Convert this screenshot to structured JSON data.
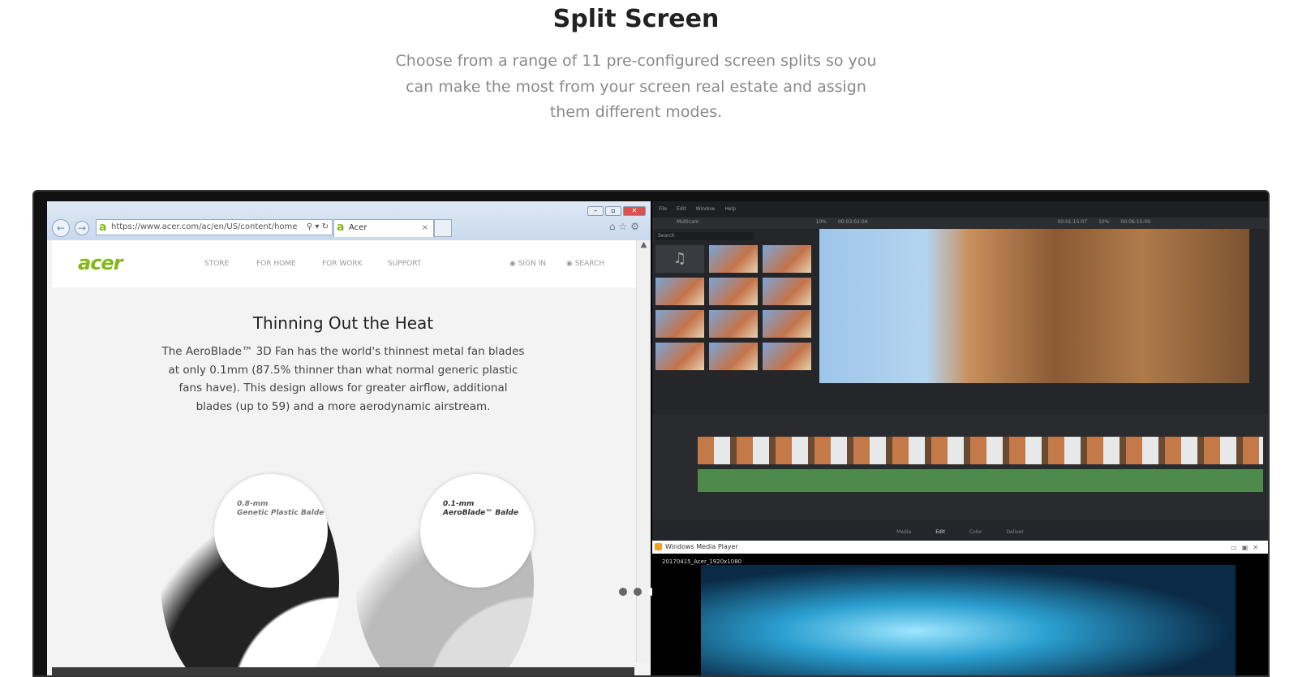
{
  "heading": "Split Screen",
  "description": "Choose from a range of 11 pre-configured screen splits so you can make the most from your screen real estate and assign them different modes.",
  "browser": {
    "url": "https://www.acer.com/ac/en/US/content/home",
    "tab_label": "Acer",
    "site": {
      "logo": "acer",
      "nav": [
        "STORE",
        "FOR HOME",
        "FOR WORK",
        "SUPPORT"
      ],
      "sign_in": "SIGN IN",
      "search": "SEARCH",
      "title": "Thinning Out the Heat",
      "body": "The AeroBlade™ 3D Fan has the world's thinnest metal fan blades at only 0.1mm (87.5% thinner than what normal generic plastic fans have). This design allows for greater airflow, additional blades (up to 59) and a more aerodynamic airstream.",
      "label_left_1": "0.8-mm",
      "label_left_2": "Genetic Plastic Balde",
      "label_right_1": "0.1-mm",
      "label_right_2": "AeroBlade™ Balde"
    },
    "carousel": {
      "count": 3,
      "active": 3
    }
  },
  "editor": {
    "menu": [
      "File",
      "Edit",
      "Window",
      "Help"
    ],
    "bin": "Multicam",
    "search_placeholder": "Search",
    "zoom_left": "10%",
    "timecode_left": "00:03:02:04",
    "timecode_mid": "00:01:15:07",
    "zoom_right": "10%",
    "timecode_right": "00:06:15:09",
    "pages": [
      "Media",
      "Edit",
      "Color",
      "Deliver"
    ]
  },
  "media_player": {
    "title": "Windows Media Player",
    "file": "20170415_Acer_1920x1080"
  }
}
